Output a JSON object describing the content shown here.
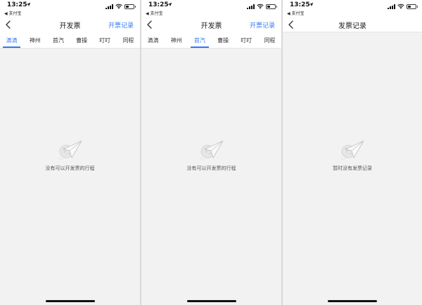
{
  "screens": [
    {
      "status": {
        "time": "13:25",
        "back_app": "◀ 支付宝"
      },
      "nav": {
        "title": "开发票",
        "action": "开票记录"
      },
      "tabs": [
        "滴滴",
        "神州",
        "首汽",
        "曹操",
        "叮叮",
        "同程"
      ],
      "active_tab": 0,
      "empty_text": "没有可以开发票的行程"
    },
    {
      "status": {
        "time": "13:25",
        "back_app": "◀ 支付宝"
      },
      "nav": {
        "title": "开发票",
        "action": "开票记录"
      },
      "tabs": [
        "滴滴",
        "神州",
        "首汽",
        "曹操",
        "叮叮",
        "同程"
      ],
      "active_tab": 2,
      "empty_text": "没有可以开发票的行程"
    },
    {
      "status": {
        "time": "13:25",
        "back_app": "◀ 支付宝"
      },
      "nav": {
        "title": "发票记录",
        "action": ""
      },
      "empty_text": "暂时没有发票记录"
    }
  ],
  "colors": {
    "accent": "#3478f6",
    "background": "#f2f2f2",
    "bar": "#ffffff"
  },
  "icons": [
    "back-chevron-icon",
    "location-arrow-icon",
    "signal-icon",
    "wifi-icon",
    "battery-icon",
    "paper-plane-empty-icon"
  ]
}
